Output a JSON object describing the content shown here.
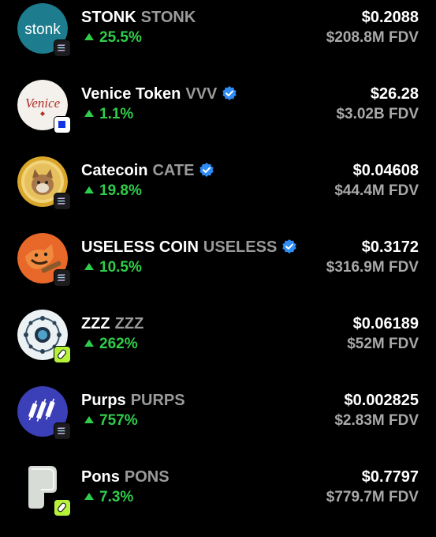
{
  "tokens": [
    {
      "name": "STONK",
      "symbol": "STONK",
      "verified": false,
      "change": "25.5%",
      "price": "$0.2088",
      "fdv": "$208.8M FDV",
      "chain": "solana-icon",
      "logo_text": "stonk"
    },
    {
      "name": "Venice Token",
      "symbol": "VVV",
      "verified": true,
      "change": "1.1%",
      "price": "$26.28",
      "fdv": "$3.02B FDV",
      "chain": "base-icon",
      "logo_text": "Venice"
    },
    {
      "name": "Catecoin",
      "symbol": "CATE",
      "verified": true,
      "change": "19.8%",
      "price": "$0.04608",
      "fdv": "$44.4M FDV",
      "chain": "solana-icon"
    },
    {
      "name": "USELESS COIN",
      "symbol": "USELESS",
      "verified": true,
      "change": "10.5%",
      "price": "$0.3172",
      "fdv": "$316.9M FDV",
      "chain": "solana-icon"
    },
    {
      "name": "ZZZ",
      "symbol": "ZZZ",
      "verified": false,
      "change": "262%",
      "price": "$0.06189",
      "fdv": "$52M FDV",
      "chain": "pump-icon"
    },
    {
      "name": "Purps",
      "symbol": "PURPS",
      "verified": false,
      "change": "757%",
      "price": "$0.002825",
      "fdv": "$2.83M FDV",
      "chain": "solana-icon"
    },
    {
      "name": "Pons",
      "symbol": "PONS",
      "verified": false,
      "change": "7.3%",
      "price": "$0.7797",
      "fdv": "$779.7M FDV",
      "chain": "pump-icon"
    }
  ],
  "colors": {
    "background": "#000000",
    "positive": "#2fce4a",
    "secondary_text": "#9a9a9a",
    "verified": "#2f8cf5"
  }
}
